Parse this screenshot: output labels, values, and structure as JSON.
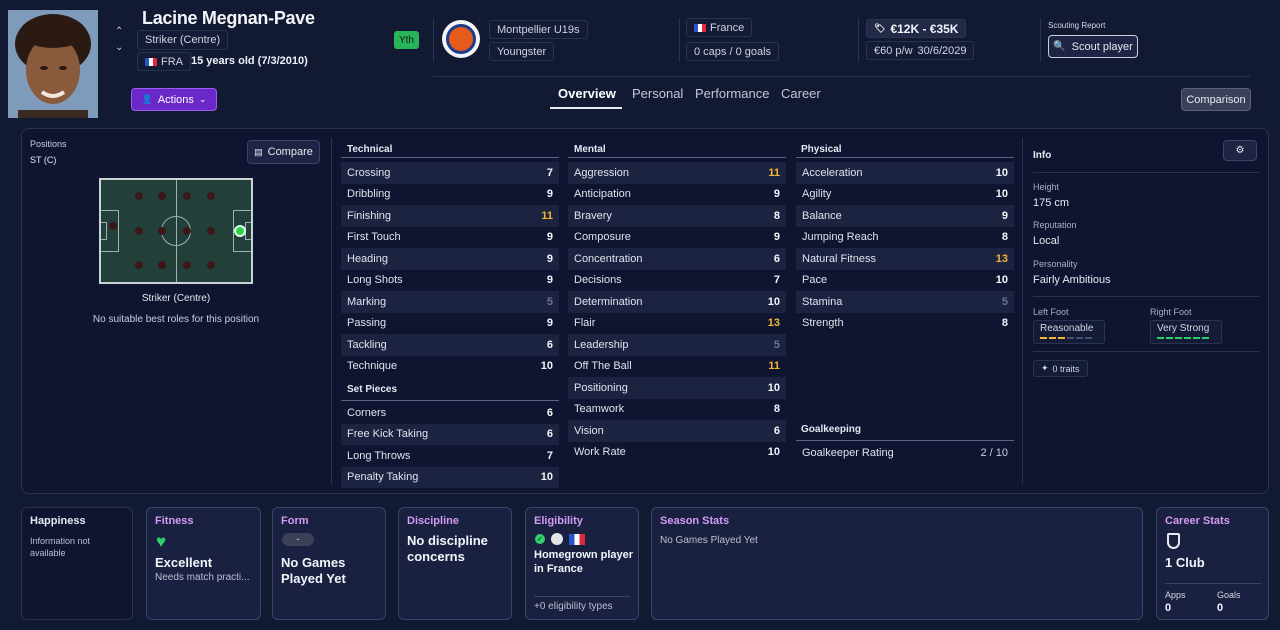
{
  "header": {
    "player_name": "Lacine Megnan-Pave",
    "position": "Striker (Centre)",
    "nationality_code": "FRA",
    "age_text": "15 years old (7/3/2010)",
    "youth_badge": "Yth",
    "club_name": "Montpellier U19s",
    "club_status": "Youngster",
    "nation": "France",
    "caps_goals": "0 caps / 0 goals",
    "value_range": "€12K - €35K",
    "wage": "€60 p/w",
    "contract_end": "30/6/2029",
    "scouting_report_label": "Scouting Report",
    "scout_button": "Scout player",
    "actions_button": "Actions",
    "comparison_button": "Comparison"
  },
  "tabs": [
    "Overview",
    "Personal",
    "Performance",
    "Career"
  ],
  "positions_panel": {
    "label": "Positions",
    "current": "ST (C)",
    "compare_button": "Compare",
    "role_name": "Striker (Centre)",
    "role_note": "No suitable best roles for this position"
  },
  "technical": {
    "title": "Technical",
    "rows": [
      {
        "name": "Crossing",
        "value": "7",
        "tone": "normal"
      },
      {
        "name": "Dribbling",
        "value": "9",
        "tone": "normal"
      },
      {
        "name": "Finishing",
        "value": "11",
        "tone": "high"
      },
      {
        "name": "First Touch",
        "value": "9",
        "tone": "normal"
      },
      {
        "name": "Heading",
        "value": "9",
        "tone": "normal"
      },
      {
        "name": "Long Shots",
        "value": "9",
        "tone": "normal"
      },
      {
        "name": "Marking",
        "value": "5",
        "tone": "low"
      },
      {
        "name": "Passing",
        "value": "9",
        "tone": "normal"
      },
      {
        "name": "Tackling",
        "value": "6",
        "tone": "normal"
      },
      {
        "name": "Technique",
        "value": "10",
        "tone": "normal"
      }
    ]
  },
  "set_pieces": {
    "title": "Set Pieces",
    "rows": [
      {
        "name": "Corners",
        "value": "6",
        "tone": "normal"
      },
      {
        "name": "Free Kick Taking",
        "value": "6",
        "tone": "normal"
      },
      {
        "name": "Long Throws",
        "value": "7",
        "tone": "normal"
      },
      {
        "name": "Penalty Taking",
        "value": "10",
        "tone": "normal"
      }
    ]
  },
  "mental": {
    "title": "Mental",
    "rows": [
      {
        "name": "Aggression",
        "value": "11",
        "tone": "high"
      },
      {
        "name": "Anticipation",
        "value": "9",
        "tone": "normal"
      },
      {
        "name": "Bravery",
        "value": "8",
        "tone": "normal"
      },
      {
        "name": "Composure",
        "value": "9",
        "tone": "normal"
      },
      {
        "name": "Concentration",
        "value": "6",
        "tone": "normal"
      },
      {
        "name": "Decisions",
        "value": "7",
        "tone": "normal"
      },
      {
        "name": "Determination",
        "value": "10",
        "tone": "normal"
      },
      {
        "name": "Flair",
        "value": "13",
        "tone": "high"
      },
      {
        "name": "Leadership",
        "value": "5",
        "tone": "low"
      },
      {
        "name": "Off The Ball",
        "value": "11",
        "tone": "high"
      },
      {
        "name": "Positioning",
        "value": "10",
        "tone": "normal"
      },
      {
        "name": "Teamwork",
        "value": "8",
        "tone": "normal"
      },
      {
        "name": "Vision",
        "value": "6",
        "tone": "normal"
      },
      {
        "name": "Work Rate",
        "value": "10",
        "tone": "normal"
      }
    ]
  },
  "physical": {
    "title": "Physical",
    "rows": [
      {
        "name": "Acceleration",
        "value": "10",
        "tone": "normal"
      },
      {
        "name": "Agility",
        "value": "10",
        "tone": "normal"
      },
      {
        "name": "Balance",
        "value": "9",
        "tone": "normal"
      },
      {
        "name": "Jumping Reach",
        "value": "8",
        "tone": "normal"
      },
      {
        "name": "Natural Fitness",
        "value": "13",
        "tone": "high"
      },
      {
        "name": "Pace",
        "value": "10",
        "tone": "normal"
      },
      {
        "name": "Stamina",
        "value": "5",
        "tone": "low"
      },
      {
        "name": "Strength",
        "value": "8",
        "tone": "normal"
      }
    ]
  },
  "goalkeeping": {
    "title": "Goalkeeping",
    "rating_label": "Goalkeeper Rating",
    "rating_value": "2 / 10"
  },
  "info": {
    "title": "Info",
    "height_label": "Height",
    "height": "175 cm",
    "reputation_label": "Reputation",
    "reputation": "Local",
    "personality_label": "Personality",
    "personality": "Fairly Ambitious",
    "left_foot_label": "Left Foot",
    "left_foot": "Reasonable",
    "left_foot_level": 3,
    "right_foot_label": "Right Foot",
    "right_foot": "Very Strong",
    "right_foot_level": 6,
    "traits": "0 traits"
  },
  "cards": {
    "happiness_title": "Happiness",
    "happiness_text": "Information not available",
    "fitness_title": "Fitness",
    "fitness_value": "Excellent",
    "fitness_note": "Needs match practi...",
    "form_title": "Form",
    "form_badge": "-",
    "form_value": "No Games Played Yet",
    "discipline_title": "Discipline",
    "discipline_value": "No discipline concerns",
    "eligibility_title": "Eligibility",
    "eligibility_value": "Homegrown player in France",
    "eligibility_more": "+0 eligibility types",
    "season_title": "Season Stats",
    "season_text": "No Games Played Yet",
    "career_title": "Career Stats",
    "career_value": "1 Club",
    "apps_label": "Apps",
    "apps": "0",
    "goals_label": "Goals",
    "goals": "0"
  },
  "colors": {
    "accent_purple": "#7d2ee0",
    "highlight": "#f2b632",
    "low": "#6c7390",
    "fitness_green": "#2fd06a",
    "youth_green": "#27b45a"
  }
}
